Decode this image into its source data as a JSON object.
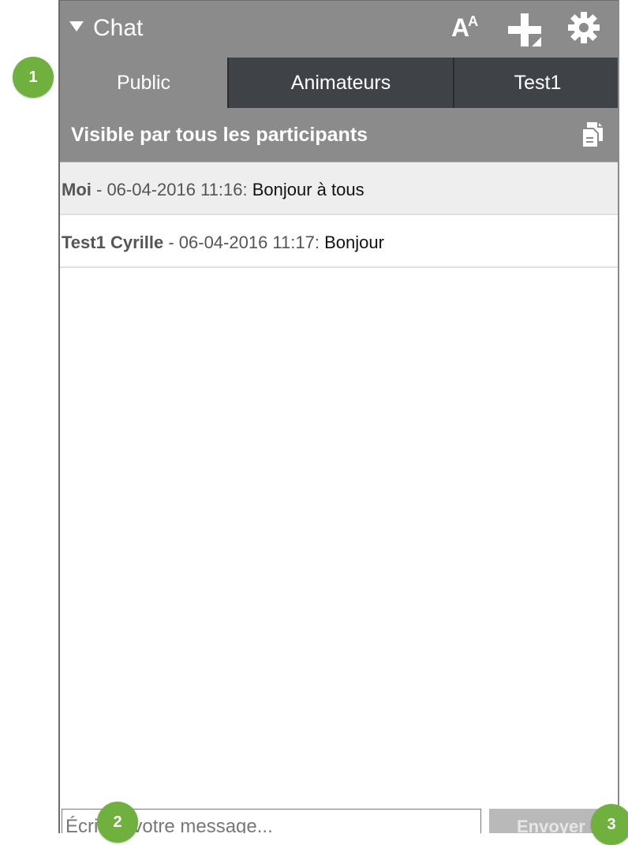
{
  "header": {
    "title": "Chat",
    "font_icon_label": "A",
    "font_icon_small": "A"
  },
  "tabs": [
    {
      "label": "Public",
      "active": true
    },
    {
      "label": "Animateurs",
      "active": false
    },
    {
      "label": "Test1",
      "active": false
    }
  ],
  "subheader": {
    "label": "Visible par tous les participants"
  },
  "messages": [
    {
      "author": "Moi",
      "timestamp": " - 06-04-2016 11:16: ",
      "text": "Bonjour à tous"
    },
    {
      "author": "Test1 Cyrille",
      "timestamp": " - 06-04-2016 11:17: ",
      "text": "Bonjour"
    }
  ],
  "composer": {
    "placeholder": "Écrivez votre message...",
    "send_label": "Envoyer"
  },
  "callouts": [
    "1",
    "2",
    "3"
  ],
  "colors": {
    "header_gray": "#8b8b8b",
    "tab_dark": "#3f4348",
    "callout_green": "#6fb03e"
  }
}
